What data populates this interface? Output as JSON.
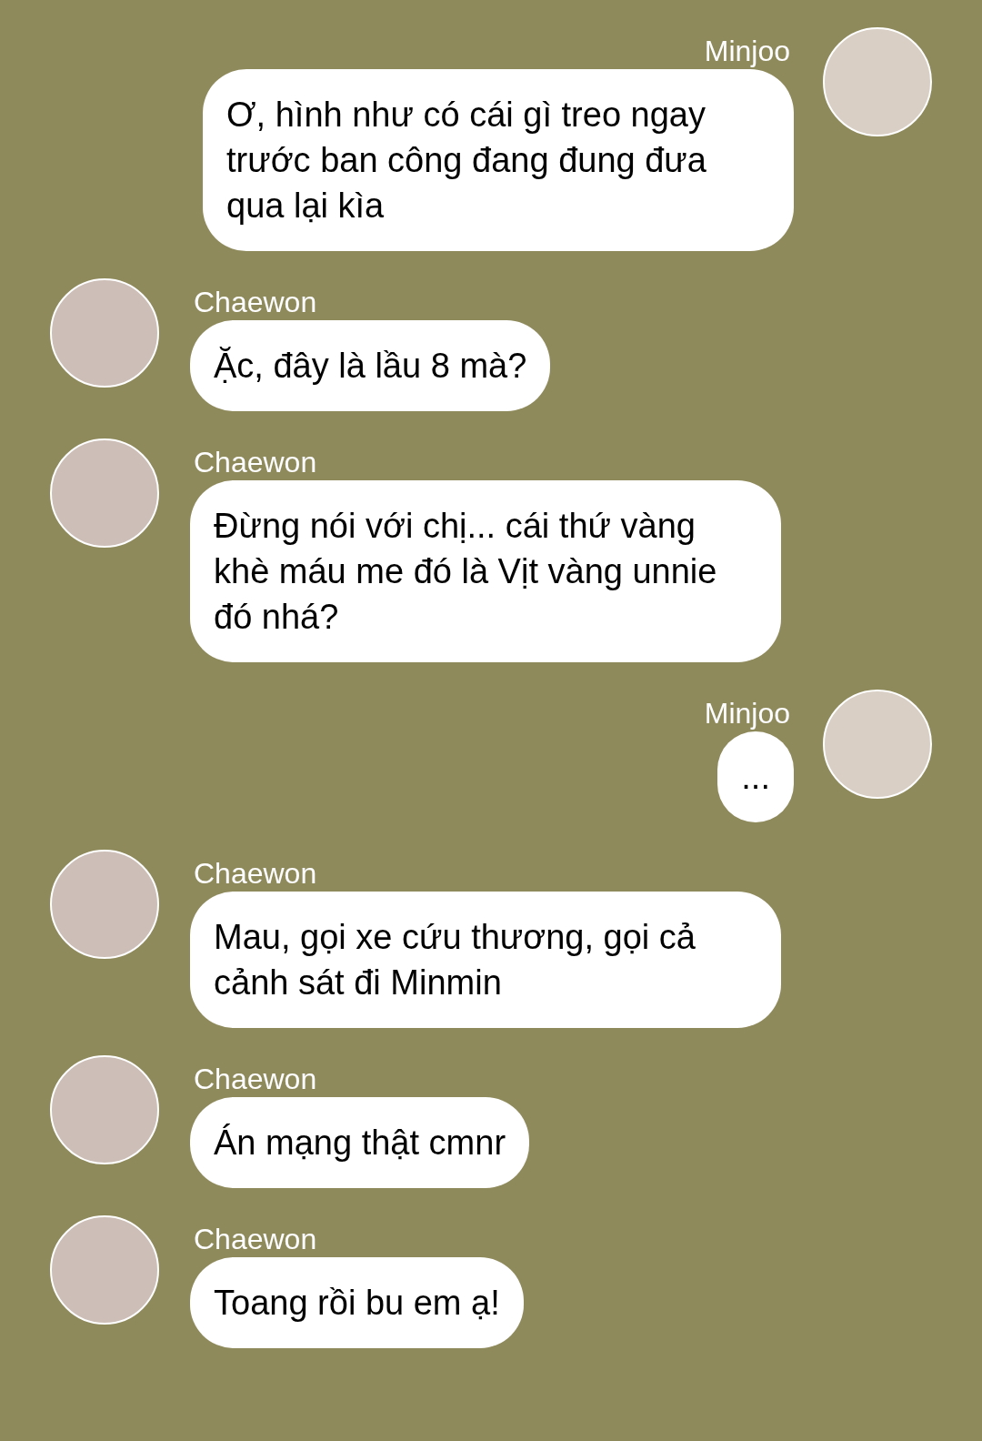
{
  "messages": [
    {
      "sender": "Minjoo",
      "kind": "outgoing",
      "text": "Ơ, hình như có cái gì treo ngay trước ban công đang đung đưa qua lại kìa"
    },
    {
      "sender": "Chaewon",
      "kind": "incoming",
      "text": "Ặc, đây là lầu 8 mà?"
    },
    {
      "sender": "Chaewon",
      "kind": "incoming",
      "text": "Đừng nói với chị... cái thứ vàng khè máu me đó là Vịt vàng unnie đó nhá?"
    },
    {
      "sender": "Minjoo",
      "kind": "outgoing",
      "text": "..."
    },
    {
      "sender": "Chaewon",
      "kind": "incoming",
      "text": "Mau, gọi xe cứu thương, gọi cả cảnh sát đi Minmin"
    },
    {
      "sender": "Chaewon",
      "kind": "incoming",
      "text": "Án mạng thật cmnr"
    },
    {
      "sender": "Chaewon",
      "kind": "incoming",
      "text": "Toang rồi bu em ạ!"
    }
  ]
}
